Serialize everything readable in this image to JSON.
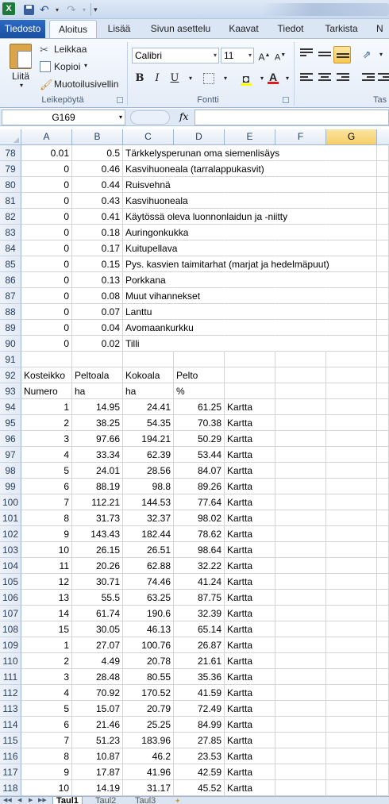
{
  "app": {
    "logo_letter": "X",
    "colors": {
      "file_tab": "#2b67be",
      "selection": "#f7cf68",
      "accent": "#1d7a3a"
    },
    "icons": [
      "excel-logo-icon",
      "save-icon",
      "undo-icon",
      "redo-icon",
      "customize-quick-access-icon"
    ]
  },
  "ribbon": {
    "tabs": [
      "Tiedosto",
      "Aloitus",
      "Lisää",
      "Sivun asettelu",
      "Kaavat",
      "Tiedot",
      "Tarkista",
      "N"
    ],
    "active_tab": "Aloitus",
    "clipboard": {
      "paste_label": "Liitä",
      "cut_label": "Leikkaa",
      "copy_label": "Kopioi",
      "format_painter_label": "Muotoilusivellin",
      "group_label": "Leikepöytä"
    },
    "font": {
      "font_name": "Calibri",
      "font_size": "11",
      "bold": "B",
      "italic": "I",
      "underline": "U",
      "group_label": "Fontti"
    },
    "alignment": {
      "group_label": "Tas"
    }
  },
  "formula_bar": {
    "name_box": "G169",
    "fx": "fx",
    "formula": ""
  },
  "columns": [
    "A",
    "B",
    "C",
    "D",
    "E",
    "F",
    "G"
  ],
  "selected_column": "G",
  "rows": [
    {
      "n": "78",
      "a": "0.01",
      "b": "0.5",
      "c": "Tärkkelysperunan oma siemenlisäys",
      "d": "",
      "e": ""
    },
    {
      "n": "79",
      "a": "0",
      "b": "0.46",
      "c": "Kasvihuoneala (tarralappukasvit)",
      "d": "",
      "e": ""
    },
    {
      "n": "80",
      "a": "0",
      "b": "0.44",
      "c": "Ruisvehnä",
      "d": "",
      "e": ""
    },
    {
      "n": "81",
      "a": "0",
      "b": "0.43",
      "c": "Kasvihuoneala",
      "d": "",
      "e": ""
    },
    {
      "n": "82",
      "a": "0",
      "b": "0.41",
      "c": "Käytössä oleva luonnonlaidun ja -niitty",
      "d": "",
      "e": ""
    },
    {
      "n": "83",
      "a": "0",
      "b": "0.18",
      "c": "Auringonkukka",
      "d": "",
      "e": ""
    },
    {
      "n": "84",
      "a": "0",
      "b": "0.17",
      "c": "Kuitupellava",
      "d": "",
      "e": ""
    },
    {
      "n": "85",
      "a": "0",
      "b": "0.15",
      "c": "Pys. kasvien taimitarhat (marjat ja hedelmäpuut)",
      "d": "",
      "e": ""
    },
    {
      "n": "86",
      "a": "0",
      "b": "0.13",
      "c": "Porkkana",
      "d": "",
      "e": ""
    },
    {
      "n": "87",
      "a": "0",
      "b": "0.08",
      "c": "Muut vihannekset",
      "d": "",
      "e": ""
    },
    {
      "n": "88",
      "a": "0",
      "b": "0.07",
      "c": "Lanttu",
      "d": "",
      "e": ""
    },
    {
      "n": "89",
      "a": "0",
      "b": "0.04",
      "c": "Avomaankurkku",
      "d": "",
      "e": ""
    },
    {
      "n": "90",
      "a": "0",
      "b": "0.02",
      "c": "Tilli",
      "d": "",
      "e": ""
    },
    {
      "n": "91",
      "a": "",
      "b": "",
      "c": "",
      "d": "",
      "e": ""
    },
    {
      "n": "92",
      "a": "Kosteikko",
      "b": "Peltoala",
      "c": "Kokoala",
      "d": "Pelto",
      "e": "",
      "header": true
    },
    {
      "n": "93",
      "a": "Numero",
      "b": "ha",
      "c": "ha",
      "d": "%",
      "e": "",
      "header": true
    },
    {
      "n": "94",
      "a": "1",
      "b": "14.95",
      "c": "24.41",
      "d": "61.25",
      "e": "Kartta"
    },
    {
      "n": "95",
      "a": "2",
      "b": "38.25",
      "c": "54.35",
      "d": "70.38",
      "e": "Kartta"
    },
    {
      "n": "96",
      "a": "3",
      "b": "97.66",
      "c": "194.21",
      "d": "50.29",
      "e": "Kartta"
    },
    {
      "n": "97",
      "a": "4",
      "b": "33.34",
      "c": "62.39",
      "d": "53.44",
      "e": "Kartta"
    },
    {
      "n": "98",
      "a": "5",
      "b": "24.01",
      "c": "28.56",
      "d": "84.07",
      "e": "Kartta"
    },
    {
      "n": "99",
      "a": "6",
      "b": "88.19",
      "c": "98.8",
      "d": "89.26",
      "e": "Kartta"
    },
    {
      "n": "100",
      "a": "7",
      "b": "112.21",
      "c": "144.53",
      "d": "77.64",
      "e": "Kartta"
    },
    {
      "n": "101",
      "a": "8",
      "b": "31.73",
      "c": "32.37",
      "d": "98.02",
      "e": "Kartta"
    },
    {
      "n": "102",
      "a": "9",
      "b": "143.43",
      "c": "182.44",
      "d": "78.62",
      "e": "Kartta"
    },
    {
      "n": "103",
      "a": "10",
      "b": "26.15",
      "c": "26.51",
      "d": "98.64",
      "e": "Kartta"
    },
    {
      "n": "104",
      "a": "11",
      "b": "20.26",
      "c": "62.88",
      "d": "32.22",
      "e": "Kartta"
    },
    {
      "n": "105",
      "a": "12",
      "b": "30.71",
      "c": "74.46",
      "d": "41.24",
      "e": "Kartta"
    },
    {
      "n": "106",
      "a": "13",
      "b": "55.5",
      "c": "63.25",
      "d": "87.75",
      "e": "Kartta"
    },
    {
      "n": "107",
      "a": "14",
      "b": "61.74",
      "c": "190.6",
      "d": "32.39",
      "e": "Kartta"
    },
    {
      "n": "108",
      "a": "15",
      "b": "30.05",
      "c": "46.13",
      "d": "65.14",
      "e": "Kartta"
    },
    {
      "n": "109",
      "a": "1",
      "b": "27.07",
      "c": "100.76",
      "d": "26.87",
      "e": "Kartta"
    },
    {
      "n": "110",
      "a": "2",
      "b": "4.49",
      "c": "20.78",
      "d": "21.61",
      "e": "Kartta"
    },
    {
      "n": "111",
      "a": "3",
      "b": "28.48",
      "c": "80.55",
      "d": "35.36",
      "e": "Kartta"
    },
    {
      "n": "112",
      "a": "4",
      "b": "70.92",
      "c": "170.52",
      "d": "41.59",
      "e": "Kartta"
    },
    {
      "n": "113",
      "a": "5",
      "b": "15.07",
      "c": "20.79",
      "d": "72.49",
      "e": "Kartta"
    },
    {
      "n": "114",
      "a": "6",
      "b": "21.46",
      "c": "25.25",
      "d": "84.99",
      "e": "Kartta"
    },
    {
      "n": "115",
      "a": "7",
      "b": "51.23",
      "c": "183.96",
      "d": "27.85",
      "e": "Kartta"
    },
    {
      "n": "116",
      "a": "8",
      "b": "10.87",
      "c": "46.2",
      "d": "23.53",
      "e": "Kartta"
    },
    {
      "n": "117",
      "a": "9",
      "b": "17.87",
      "c": "41.96",
      "d": "42.59",
      "e": "Kartta"
    },
    {
      "n": "118",
      "a": "10",
      "b": "14.19",
      "c": "31.17",
      "d": "45.52",
      "e": "Kartta"
    }
  ],
  "sheets": [
    "Taul1",
    "Taul2",
    "Taul3"
  ],
  "active_sheet": "Taul1"
}
